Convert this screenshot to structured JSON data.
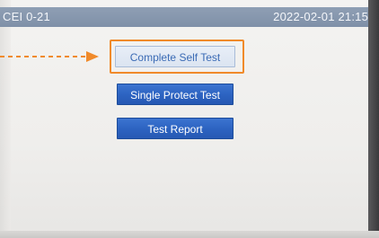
{
  "header": {
    "title": "CEI 0-21",
    "datetime": "2022-02-01  21:15"
  },
  "menu": {
    "buttons": [
      {
        "label": "Complete Self Test",
        "selected": true
      },
      {
        "label": "Single Protect Test",
        "selected": false
      },
      {
        "label": "Test Report",
        "selected": false
      }
    ]
  },
  "annotation": {
    "color": "#f08a2a",
    "icon": "dashed-arrow-right-icon"
  },
  "colors": {
    "title_bar": "#8394ac",
    "button_blue": "#2d64c2",
    "selected_button": "#dbe4f1"
  }
}
